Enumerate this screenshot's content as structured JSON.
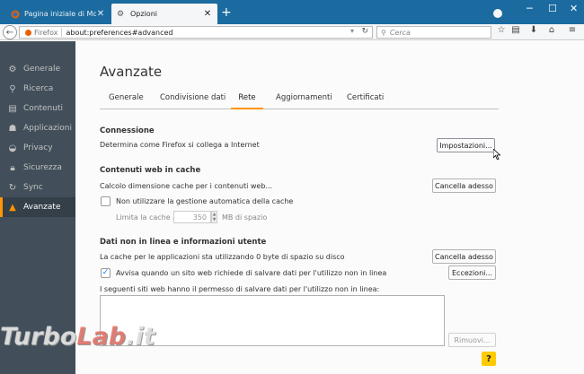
{
  "browser": {
    "tabs": [
      {
        "title": "Pagina iniziale di Mozilla F...",
        "active": false
      },
      {
        "title": "Opzioni",
        "active": true
      }
    ],
    "url_identity": "Firefox",
    "url": "about:preferences#advanced",
    "search_placeholder": "Cerca"
  },
  "sidebar": {
    "items": [
      {
        "label": "Generale",
        "icon": "gear-icon"
      },
      {
        "label": "Ricerca",
        "icon": "search-icon"
      },
      {
        "label": "Contenuti",
        "icon": "document-icon"
      },
      {
        "label": "Applicazioni",
        "icon": "applications-icon"
      },
      {
        "label": "Privacy",
        "icon": "mask-icon"
      },
      {
        "label": "Sicurezza",
        "icon": "lock-icon"
      },
      {
        "label": "Sync",
        "icon": "sync-icon"
      },
      {
        "label": "Avanzate",
        "icon": "wizard-hat-icon",
        "selected": true
      }
    ],
    "accent_color": "#ff9500"
  },
  "page": {
    "title": "Avanzate",
    "subtabs": [
      "Generale",
      "Condivisione dati",
      "Rete",
      "Aggiornamenti",
      "Certificati"
    ],
    "selected_subtab": "Rete"
  },
  "connection": {
    "heading": "Connessione",
    "description": "Determina come Firefox si collega a Internet",
    "button": "Impostazioni..."
  },
  "cache": {
    "heading": "Contenuti web in cache",
    "description": "Calcolo dimensione cache per i contenuti web...",
    "button": "Cancella adesso",
    "override_label": "Non utilizzare la gestione automatica della cache",
    "override_checked": false,
    "limit_label": "Limita la cache a",
    "limit_value": "350",
    "limit_unit": "MB di spazio"
  },
  "offline": {
    "heading": "Dati non in linea e informazioni utente",
    "description": "La cache per le applicazioni sta utilizzando 0 byte di spazio su disco",
    "clear_button": "Cancella adesso",
    "notify_label": "Avvisa quando un sito web richiede di salvare dati per l'utilizzo non in linea",
    "notify_checked": true,
    "exceptions_button": "Eccezioni...",
    "sites_label": "I seguenti siti web hanno il permesso di salvare dati per l'utilizzo non in linea:",
    "remove_button": "Rimuovi..."
  },
  "help_label": "?",
  "watermark": {
    "part1": "Turbo",
    "part2": "Lab",
    "part3": ".it"
  }
}
